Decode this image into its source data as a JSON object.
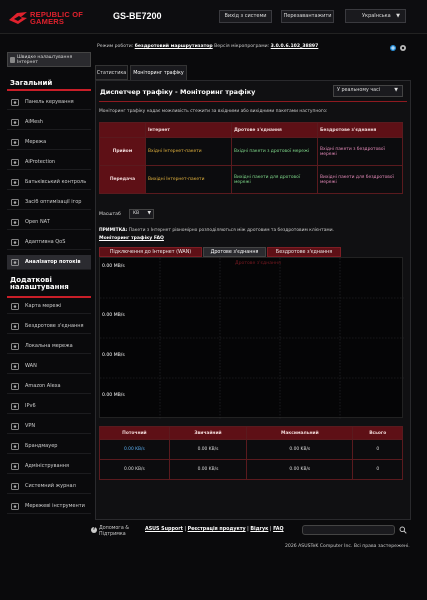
{
  "header": {
    "brand_line1": "REPUBLIC OF",
    "brand_line2": "GAMERS",
    "model": "GS-BE7200",
    "logout": "Вихід з системи",
    "reboot": "Перезавантажити",
    "language": "Українська"
  },
  "status": {
    "mode_label": "Режим роботи:",
    "mode_value": "бездротовий маршрутизатор",
    "fw_label": "Версія мікропрограми:",
    "fw_value": "3.0.0.6.102_38897"
  },
  "sidebar": {
    "qis": "Швидке налаштування Інтернет",
    "general_header": "Загальний",
    "general_items": [
      {
        "label": "Панель керування",
        "icon": "dashboard-icon"
      },
      {
        "label": "AiMesh",
        "icon": "aimesh-icon"
      },
      {
        "label": "Мережа",
        "icon": "network-icon"
      },
      {
        "label": "AiProtection",
        "icon": "shield-icon"
      },
      {
        "label": "Батьківський контроль",
        "icon": "parental-icon"
      },
      {
        "label": "Засіб оптимізації ігор",
        "icon": "game-icon"
      },
      {
        "label": "Open NAT",
        "icon": "nat-icon"
      },
      {
        "label": "Адаптивна QoS",
        "icon": "qos-icon"
      },
      {
        "label": "Аналізатор потоків",
        "icon": "analyzer-icon"
      }
    ],
    "advanced_header": "Додаткові налаштування",
    "advanced_items": [
      {
        "label": "Карта мережі",
        "icon": "map-icon"
      },
      {
        "label": "Бездротове з'єднання",
        "icon": "wifi-icon"
      },
      {
        "label": "Локальна мережа",
        "icon": "lan-icon"
      },
      {
        "label": "WAN",
        "icon": "globe-icon"
      },
      {
        "label": "Amazon Alexa",
        "icon": "alexa-icon"
      },
      {
        "label": "IPv6",
        "icon": "ipv6-icon"
      },
      {
        "label": "VPN",
        "icon": "vpn-icon"
      },
      {
        "label": "Брандмауер",
        "icon": "firewall-icon"
      },
      {
        "label": "Адміністрування",
        "icon": "admin-icon"
      },
      {
        "label": "Системний журнал",
        "icon": "log-icon"
      },
      {
        "label": "Мережеві інструменти",
        "icon": "tools-icon"
      }
    ]
  },
  "tabs": [
    "Статистика",
    "Моніторинг трафіку"
  ],
  "page": {
    "title": "Диспетчер трафіку - Моніторинг трафіку",
    "realtime": "У реальному часі",
    "description": "Моніторинг трафіку надає можливість стежити за вхідними або вихідними пакетами наступного:",
    "table_headers": [
      "Інтернет",
      "Дротове з'єднання",
      "Бездротове з'єднання"
    ],
    "row_receive": "Прийом",
    "row_transmit": "Передача",
    "rx_internet": "Вхідні Інтернет-пакети",
    "rx_wired": "Вхідні пакети з дротової мережі",
    "rx_wireless": "Вхідні пакети з бездротової мережі",
    "tx_internet": "Вихідні Інтернет-пакети",
    "tx_wired": "Вихідні пакети для дротової мережі",
    "tx_wireless": "Вихідні пакети для бездротової мережі",
    "scale_label": "Масштаб",
    "scale_value": "KB",
    "note_bold": "ПРИМІТКА:",
    "note_text": " Пакети з Інтернет рівномірно розподіляються між дротовим та бездротовим клієнтами.",
    "faq": "Моніторинг трафіку FAQ"
  },
  "graph": {
    "tabs": [
      "Підключення до Інтернет (WAN)",
      "Дротове з'єднання",
      "Бездротове з'єднання"
    ],
    "title": "Дротове з'єднання",
    "ticks": [
      "0.00 MB/s",
      "0.00 MB/s",
      "0.00 MB/s",
      "0.00 MB/s"
    ]
  },
  "stats": {
    "headers": [
      "Поточний",
      "Звичайний",
      "Максимальний",
      "Всього"
    ],
    "row1": [
      "0.00 KB/s",
      "0.00 KB/s",
      "0.00 KB/s",
      "0"
    ],
    "row2": [
      "0.00 KB/s",
      "0.00 KB/s",
      "0.00 KB/s",
      "0"
    ]
  },
  "footer": {
    "help1": "Допомога &",
    "help2": "Підтримка",
    "link1": "ASUS Support",
    "link2": "Реєстрація продукту",
    "link3": "Відгук",
    "link4": "FAQ",
    "sep": " | ",
    "copyright": "2026 ASUSTeK Computer Inc. Всі права застережені."
  },
  "colors": {
    "accent": "#c81e28",
    "header_cell": "#5e1016",
    "yellow": "#e3b33e",
    "green": "#7fd98a",
    "pink": "#e58ab9"
  }
}
